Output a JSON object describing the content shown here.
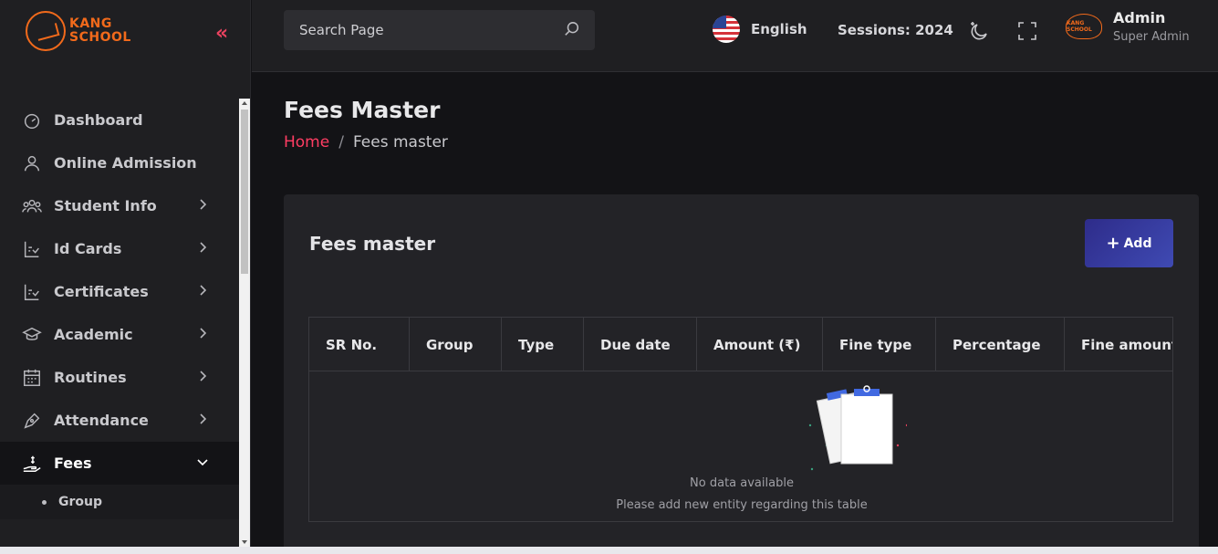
{
  "brand": {
    "line1": "KANG",
    "line2": "SCHOOL"
  },
  "header": {
    "search_placeholder": "Search Page",
    "language": "English",
    "session": "Sessions: 2024",
    "user_name": "Admin",
    "user_role": "Super Admin",
    "profile_logo_text": "KANG SCHOOL"
  },
  "sidebar": {
    "items": [
      {
        "label": "Dashboard",
        "icon": "dashboard-icon"
      },
      {
        "label": "Online Admission",
        "icon": "user-icon"
      },
      {
        "label": "Student Info",
        "icon": "users-icon"
      },
      {
        "label": "Id Cards",
        "icon": "id-card-icon"
      },
      {
        "label": "Certificates",
        "icon": "certificate-icon"
      },
      {
        "label": "Academic",
        "icon": "graduation-cap-icon"
      },
      {
        "label": "Routines",
        "icon": "calendar-icon"
      },
      {
        "label": "Attendance",
        "icon": "pen-icon"
      },
      {
        "label": "Fees",
        "icon": "fees-hand-icon"
      }
    ],
    "sub_items": [
      {
        "label": "Group"
      }
    ]
  },
  "page": {
    "title": "Fees Master",
    "breadcrumb_home": "Home",
    "breadcrumb_sep": "/",
    "breadcrumb_current": "Fees master"
  },
  "card": {
    "title": "Fees master",
    "add_label": "Add",
    "columns": [
      "SR No.",
      "Group",
      "Type",
      "Due date",
      "Amount (₹)",
      "Fine type",
      "Percentage",
      "Fine amount ("
    ],
    "empty_message": "No data available",
    "empty_sub": "Please add new entity regarding this table"
  },
  "colors": {
    "accent": "#ff3d63",
    "brand": "#f26a1b",
    "button": "#3f4ab3"
  }
}
